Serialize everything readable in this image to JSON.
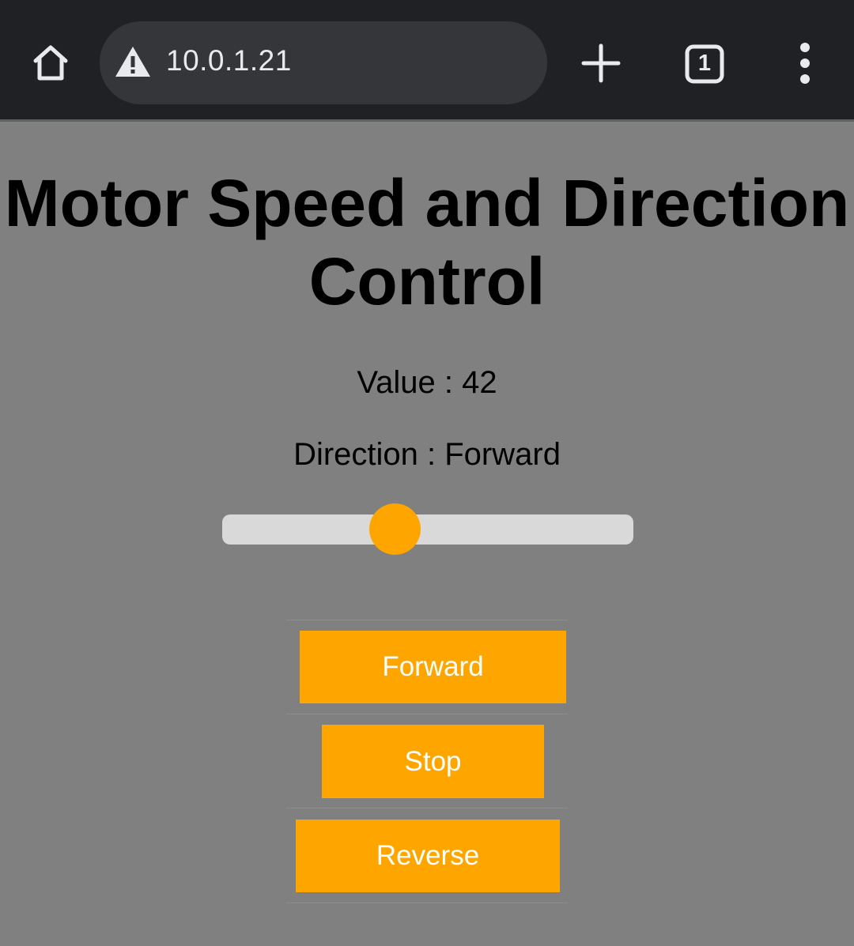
{
  "browser": {
    "url": "10.0.1.21",
    "tab_count": "1",
    "icons": [
      "home-icon",
      "warning-icon",
      "plus-icon",
      "tabs-icon",
      "more-vert-icon"
    ]
  },
  "page": {
    "title": "Motor Speed and Direction Control",
    "value_text": "Value : 42",
    "direction_text": "Direction : Forward",
    "slider": {
      "value": 42,
      "min": 0,
      "max": 100
    },
    "buttons": {
      "forward": "Forward",
      "stop": "Stop",
      "reverse": "Reverse"
    }
  },
  "colors": {
    "page_background": "#808080",
    "accent": "#ffa500",
    "toolbar": "#202124"
  }
}
